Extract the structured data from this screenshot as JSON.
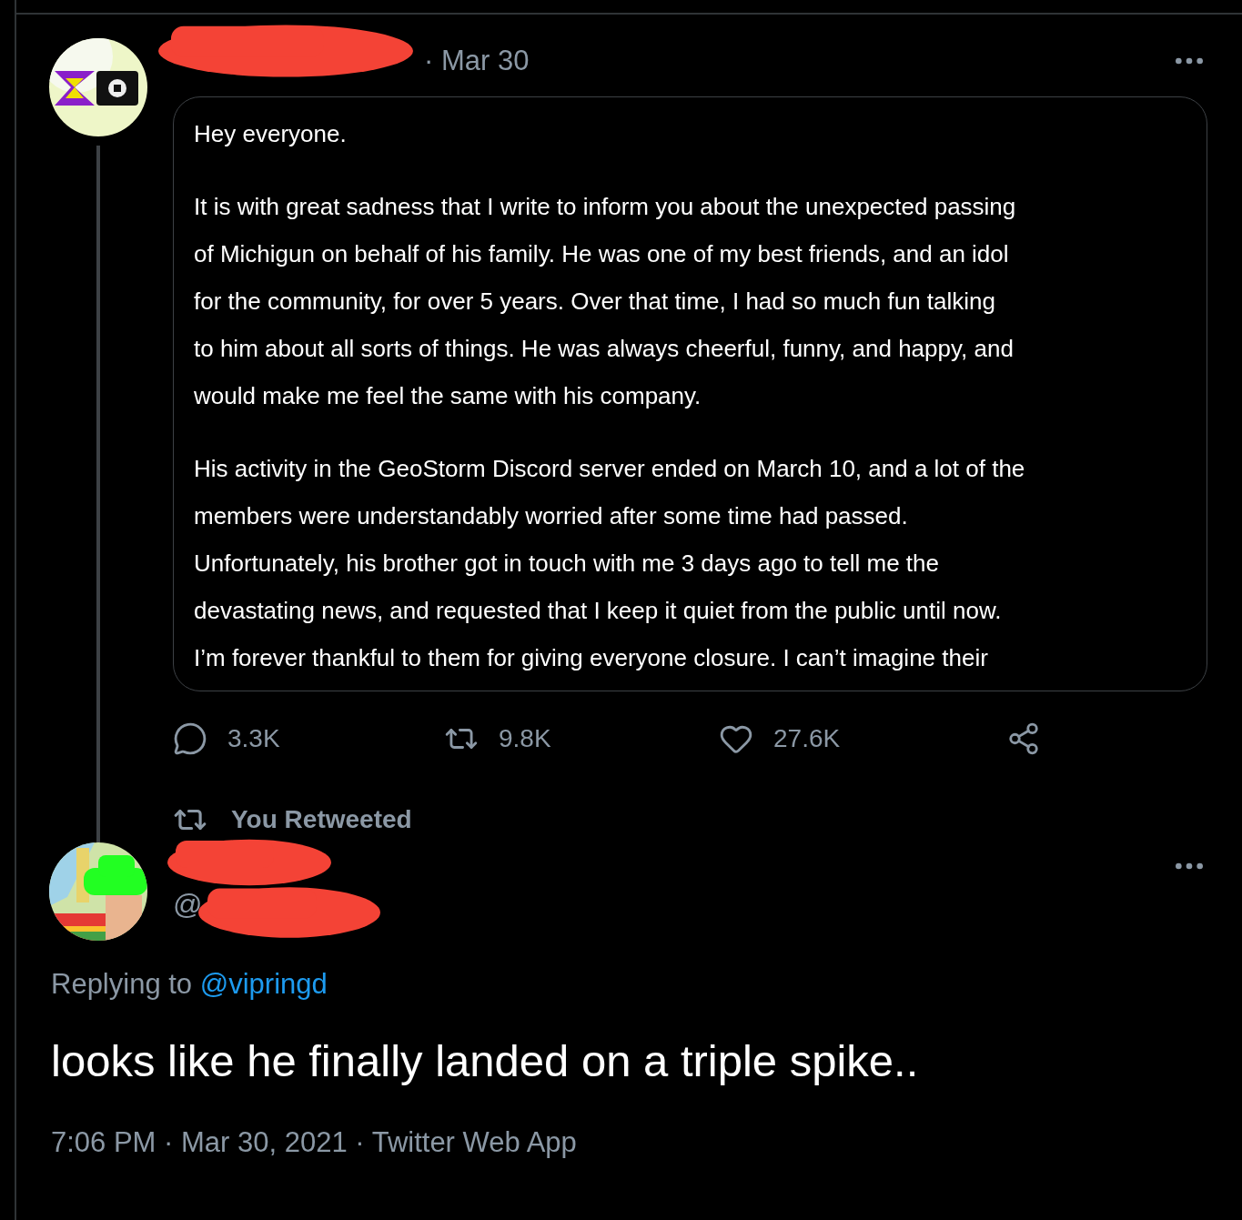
{
  "original_tweet": {
    "date": "· Mar 30",
    "image_text": [
      [
        "Hey everyone."
      ],
      [
        "It is with great sadness that I write to inform you about the unexpected passing",
        "of Michigun on behalf of his family. He was one of my best friends, and an idol",
        "for the community, for over 5 years. Over that time, I had so much fun talking",
        "to him about all sorts of things. He was always cheerful, funny, and happy, and",
        "would make me feel the same with his company."
      ],
      [
        "His activity in the GeoStorm Discord server ended on March 10, and a lot of the",
        "members were understandably worried after some time had passed.",
        "Unfortunately, his brother got in touch with me 3 days ago to tell me the",
        "devastating news, and requested that I keep it quiet from the public until now.",
        "I’m forever thankful to them for giving everyone closure. I can’t imagine their"
      ]
    ],
    "actions": [
      {
        "kind": "reply",
        "count": "3.3K"
      },
      {
        "kind": "retweet",
        "count": "9.8K"
      },
      {
        "kind": "like",
        "count": "27.6K"
      },
      {
        "kind": "share"
      }
    ]
  },
  "retweet_label": "You Retweeted",
  "reply_tweet": {
    "handle": "@",
    "replying_prefix": "Replying to",
    "replying_handle": "@vipringd",
    "text": "looks like he finally landed on a triple spike..",
    "timestamp": "7:06 PM · Mar 30, 2021 · Twitter Web App"
  }
}
